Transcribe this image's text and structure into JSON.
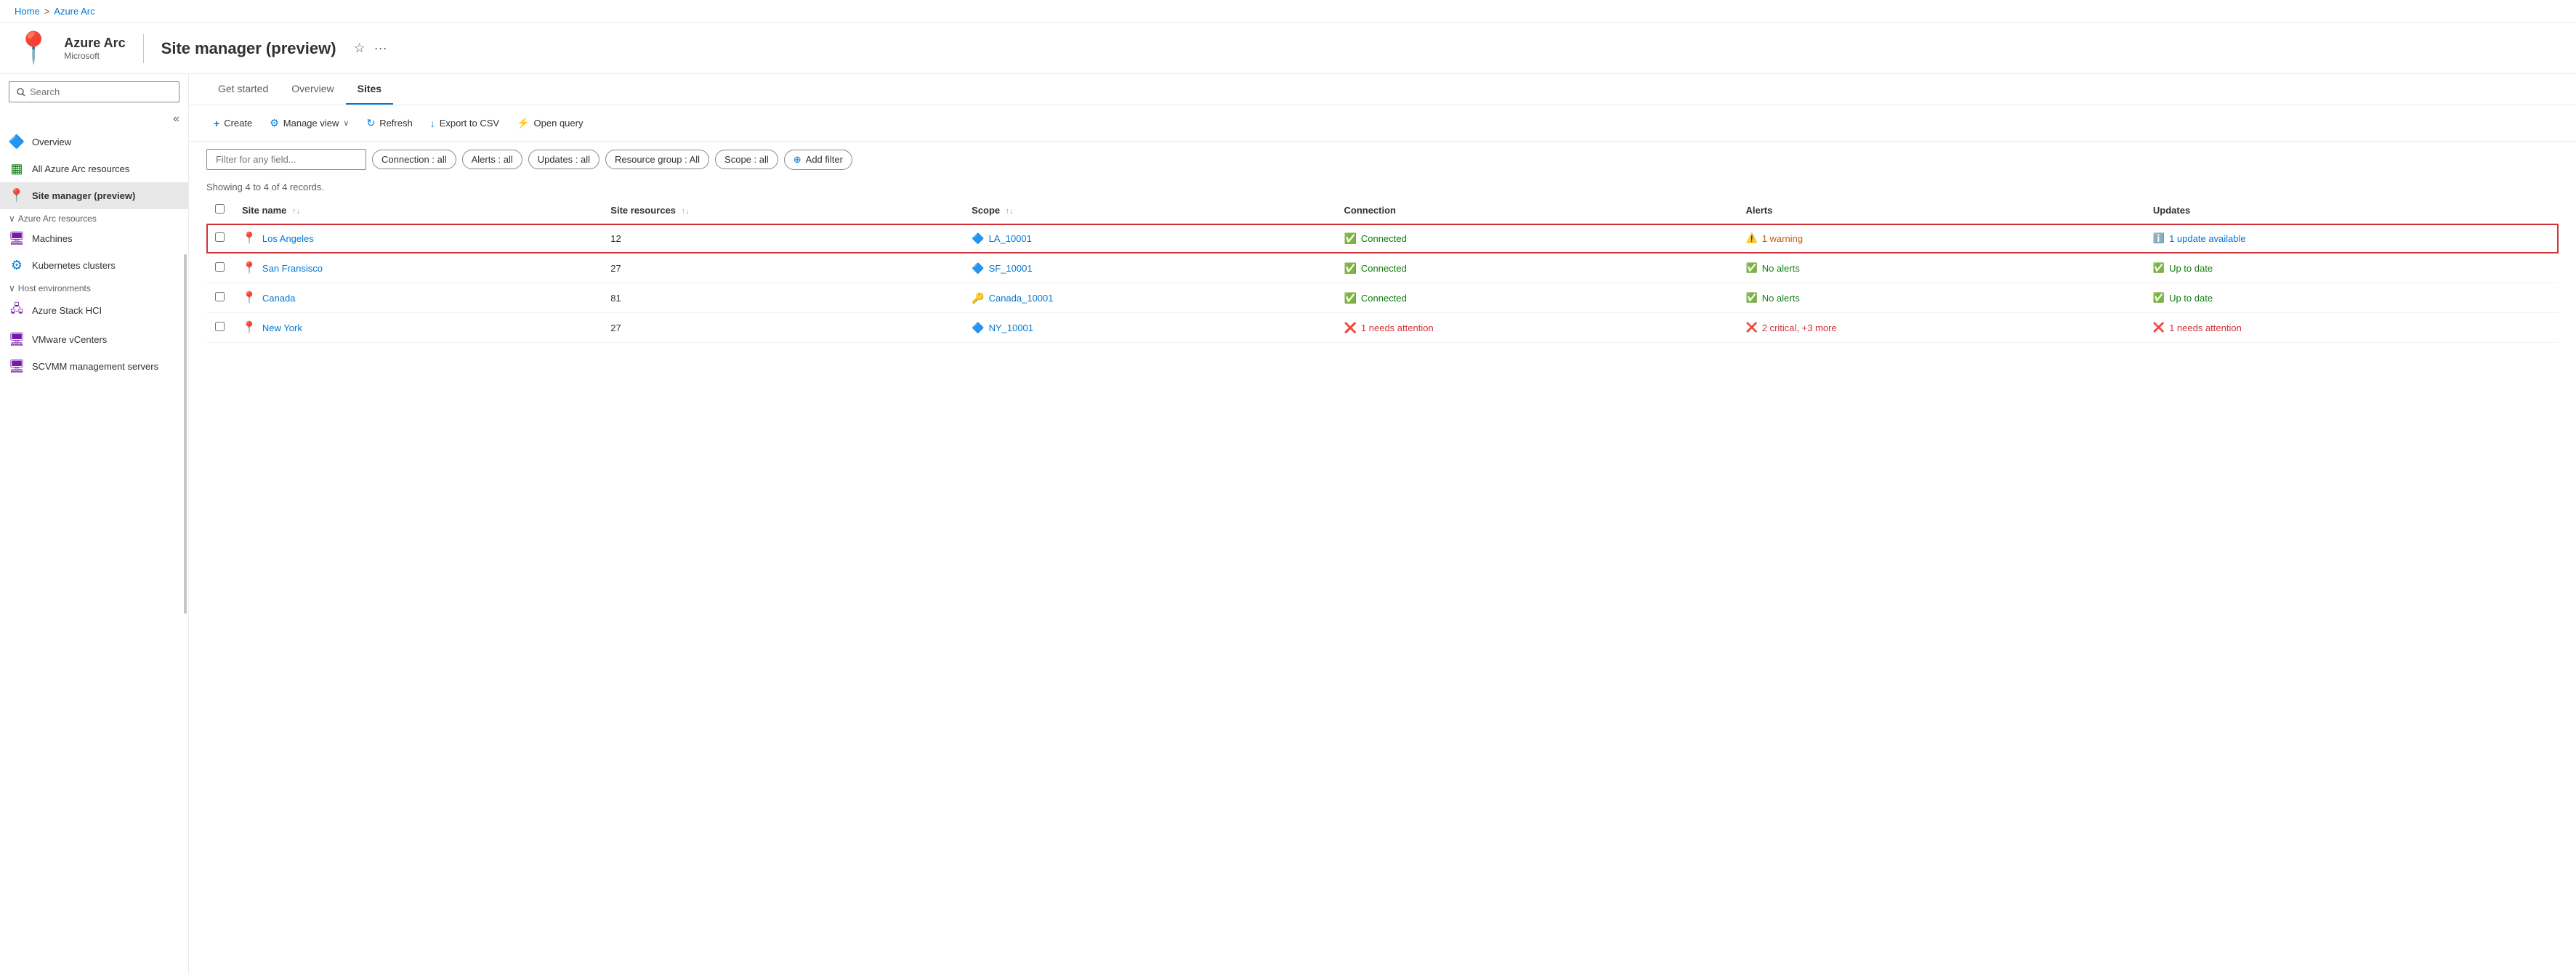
{
  "breadcrumb": {
    "home": "Home",
    "separator": ">",
    "current": "Azure Arc"
  },
  "header": {
    "icon": "📍",
    "app_name": "Azure Arc",
    "subtitle": "Microsoft",
    "divider": "|",
    "page_title": "Site manager (preview)",
    "pin_icon": "⚲",
    "more_icon": "···"
  },
  "sidebar": {
    "search_placeholder": "Search",
    "collapse_icon": "«",
    "items": [
      {
        "id": "overview",
        "label": "Overview",
        "icon": "🔷"
      },
      {
        "id": "all-resources",
        "label": "All Azure Arc resources",
        "icon": "▦"
      },
      {
        "id": "site-manager",
        "label": "Site manager (preview)",
        "icon": "📍",
        "active": true
      },
      {
        "id": "azure-arc-resources",
        "label": "Azure Arc resources",
        "section": true,
        "icon": "∨"
      },
      {
        "id": "machines",
        "label": "Machines",
        "icon": "🖥"
      },
      {
        "id": "k8s",
        "label": "Kubernetes clusters",
        "icon": "⚙"
      },
      {
        "id": "host-environments",
        "label": "Host environments",
        "section": true,
        "icon": "∨"
      },
      {
        "id": "hci",
        "label": "Azure Stack HCI",
        "icon": "🖧"
      },
      {
        "id": "vmware",
        "label": "VMware vCenters",
        "icon": "🖥"
      },
      {
        "id": "scvmm",
        "label": "SCVMM management servers",
        "icon": "🖥"
      }
    ]
  },
  "tabs": [
    {
      "id": "get-started",
      "label": "Get started",
      "active": false
    },
    {
      "id": "overview",
      "label": "Overview",
      "active": false
    },
    {
      "id": "sites",
      "label": "Sites",
      "active": true
    }
  ],
  "toolbar": {
    "create_label": "Create",
    "create_icon": "+",
    "manage_view_label": "Manage view",
    "manage_view_icon": "⚙",
    "manage_view_chevron": "∨",
    "refresh_label": "Refresh",
    "refresh_icon": "↻",
    "export_label": "Export to CSV",
    "export_icon": "↓",
    "query_label": "Open query",
    "query_icon": "⚡"
  },
  "filters": {
    "placeholder": "Filter for any field...",
    "chips": [
      {
        "id": "connection",
        "label": "Connection : all"
      },
      {
        "id": "alerts",
        "label": "Alerts : all"
      },
      {
        "id": "updates",
        "label": "Updates : all"
      },
      {
        "id": "resource-group",
        "label": "Resource group : All"
      },
      {
        "id": "scope",
        "label": "Scope : all"
      }
    ],
    "add_filter_icon": "⊕",
    "add_filter_label": "Add filter"
  },
  "record_count": "Showing 4 to 4 of 4 records.",
  "table": {
    "columns": [
      {
        "id": "site-name",
        "label": "Site name",
        "sortable": true
      },
      {
        "id": "site-resources",
        "label": "Site resources",
        "sortable": true
      },
      {
        "id": "scope",
        "label": "Scope",
        "sortable": true
      },
      {
        "id": "connection",
        "label": "Connection",
        "sortable": false
      },
      {
        "id": "alerts",
        "label": "Alerts",
        "sortable": false
      },
      {
        "id": "updates",
        "label": "Updates",
        "sortable": false
      }
    ],
    "rows": [
      {
        "id": "los-angeles",
        "site_name": "Los Angeles",
        "site_icon": "pin-blue",
        "site_resources": "12",
        "scope": "LA_10001",
        "scope_icon": "cube",
        "connection": "Connected",
        "connection_status": "ok",
        "alerts": "1 warning",
        "alerts_status": "warning",
        "updates": "1 update available",
        "updates_status": "info",
        "highlighted": true
      },
      {
        "id": "san-fransisco",
        "site_name": "San Fransisco",
        "site_icon": "pin-purple",
        "site_resources": "27",
        "scope": "SF_10001",
        "scope_icon": "cube",
        "connection": "Connected",
        "connection_status": "ok",
        "alerts": "No alerts",
        "alerts_status": "ok",
        "updates": "Up to date",
        "updates_status": "ok",
        "highlighted": false
      },
      {
        "id": "canada",
        "site_name": "Canada",
        "site_icon": "pin-blue",
        "site_resources": "81",
        "scope": "Canada_10001",
        "scope_icon": "key",
        "connection": "Connected",
        "connection_status": "ok",
        "alerts": "No alerts",
        "alerts_status": "ok",
        "updates": "Up to date",
        "updates_status": "ok",
        "highlighted": false
      },
      {
        "id": "new-york",
        "site_name": "New York",
        "site_icon": "pin-purple",
        "site_resources": "27",
        "scope": "NY_10001",
        "scope_icon": "cube",
        "connection": "1 needs attention",
        "connection_status": "error",
        "alerts": "2 critical, +3 more",
        "alerts_status": "error",
        "updates": "1 needs attention",
        "updates_status": "error",
        "highlighted": false
      }
    ]
  }
}
